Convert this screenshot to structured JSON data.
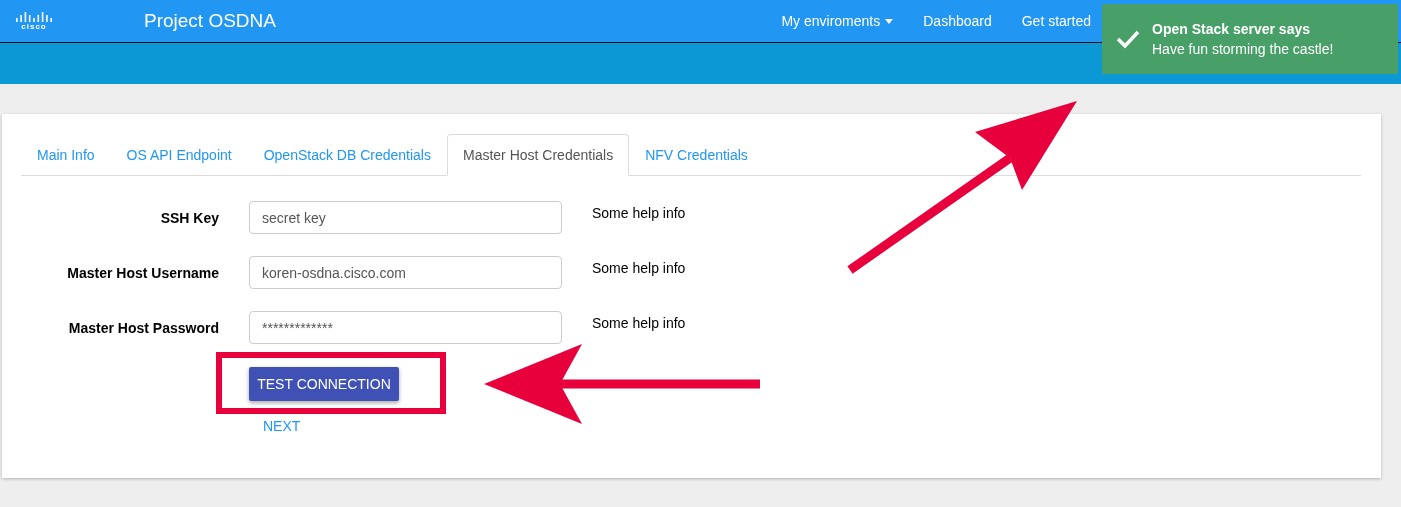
{
  "header": {
    "logo_text": "cisco",
    "title": "Project OSDNA",
    "nav": [
      {
        "label": "My enviroments",
        "dropdown": true
      },
      {
        "label": "Dashboard",
        "dropdown": false
      },
      {
        "label": "Get started",
        "dropdown": false
      }
    ]
  },
  "toast": {
    "title": "Open Stack server says",
    "message": "Have fun storming the castle!"
  },
  "tabs": [
    {
      "label": "Main Info",
      "selected": false
    },
    {
      "label": "OS API Endpoint",
      "selected": false
    },
    {
      "label": "OpenStack DB Credentials",
      "selected": false
    },
    {
      "label": "Master Host Credentials",
      "selected": true
    },
    {
      "label": "NFV Credentials",
      "selected": false
    }
  ],
  "fields": [
    {
      "label": "SSH Key",
      "value": "secret key",
      "help": "Some help info"
    },
    {
      "label": "Master Host Username",
      "value": "koren-osdna.cisco.com",
      "help": "Some help info"
    },
    {
      "label": "Master Host Password",
      "value": "*************",
      "help": "Some help info"
    }
  ],
  "test_button": "TEST CONNECTION",
  "next_link": "NEXT"
}
